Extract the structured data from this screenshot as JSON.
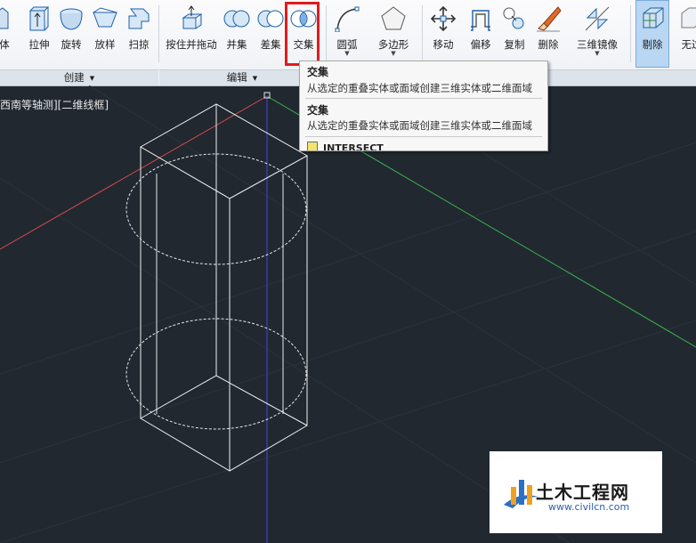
{
  "ribbon": {
    "tools": [
      {
        "id": "ti",
        "label": "体"
      },
      {
        "id": "extrude",
        "label": "拉伸"
      },
      {
        "id": "revolve",
        "label": "旋转"
      },
      {
        "id": "loft",
        "label": "放样"
      },
      {
        "id": "sweep",
        "label": "扫掠"
      },
      {
        "id": "presspull",
        "label": "按住并拖动"
      },
      {
        "id": "union",
        "label": "并集"
      },
      {
        "id": "subtract",
        "label": "差集"
      },
      {
        "id": "intersect",
        "label": "交集"
      },
      {
        "id": "arc",
        "label": "圆弧"
      },
      {
        "id": "polygon",
        "label": "多边形"
      },
      {
        "id": "move",
        "label": "移动"
      },
      {
        "id": "offset",
        "label": "偏移"
      },
      {
        "id": "copy",
        "label": "复制"
      },
      {
        "id": "erase",
        "label": "删除"
      },
      {
        "id": "mirror3d",
        "label": "三维镜像"
      },
      {
        "id": "cull",
        "label": "剔除"
      },
      {
        "id": "nofilter",
        "label": "无过"
      }
    ],
    "panels": {
      "create": "创建",
      "edit": "编辑"
    }
  },
  "viewport": {
    "label": "[西南等轴测][二维线框]",
    "visible_label": "西南等轴测][二维线框]"
  },
  "tooltip": {
    "title1": "交集",
    "desc1": "从选定的重叠实体或面域创建三维实体或二维面域",
    "title2": "交集",
    "desc2": "从选定的重叠实体或面域创建三维实体或二维面域",
    "command": "INTERSECT"
  },
  "watermark": {
    "name": "土木工程网",
    "url": "www.civilcn.com"
  },
  "colors": {
    "x_axis": "#d24a4a",
    "y_axis": "#38b24a",
    "z_axis": "#3a40c8",
    "background": "#212830",
    "highlight": "#e11c1c"
  }
}
